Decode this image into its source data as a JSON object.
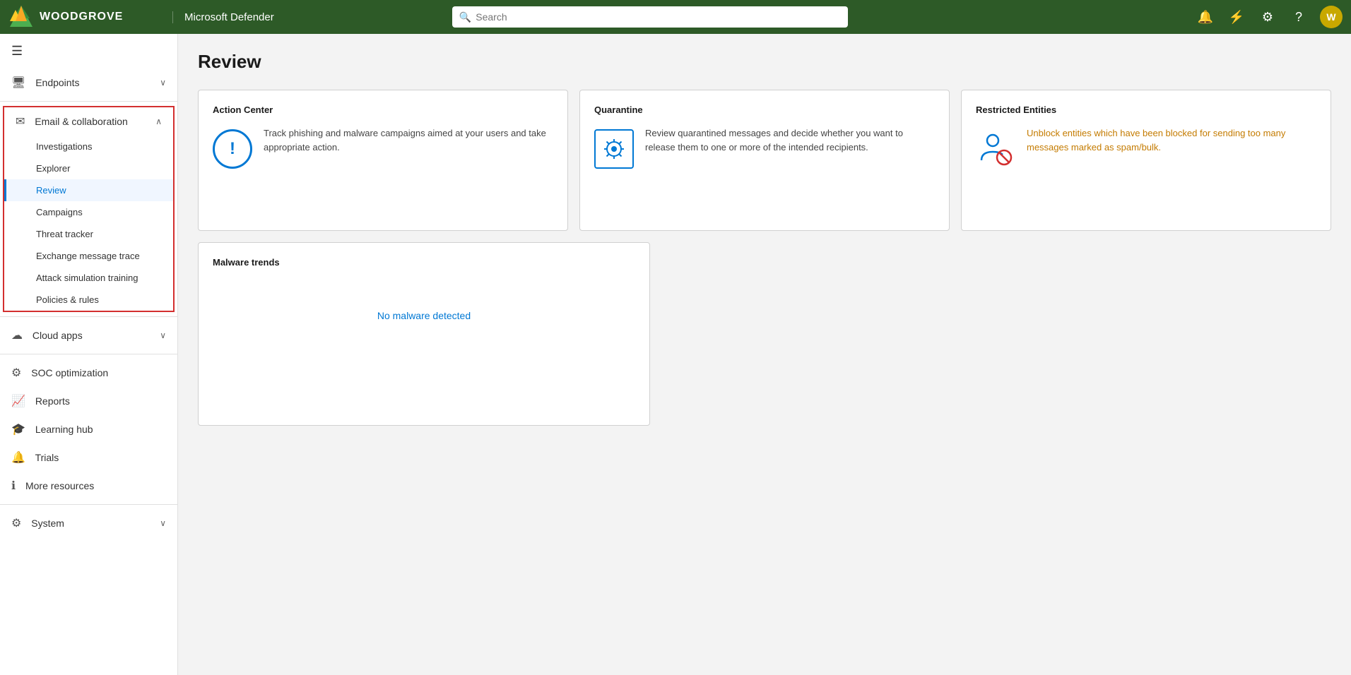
{
  "topnav": {
    "logo_text": "WOODGROVE",
    "app_title": "Microsoft Defender",
    "search_placeholder": "Search",
    "avatar_initials": "W"
  },
  "sidebar": {
    "hamburger_label": "☰",
    "sections": [
      {
        "id": "endpoints",
        "icon": "🖥",
        "label": "Endpoints",
        "expanded": false,
        "items": []
      },
      {
        "id": "email-collaboration",
        "icon": "✉",
        "label": "Email & collaboration",
        "expanded": true,
        "highlighted": true,
        "items": [
          {
            "id": "investigations",
            "label": "Investigations",
            "active": false
          },
          {
            "id": "explorer",
            "label": "Explorer",
            "active": false
          },
          {
            "id": "review",
            "label": "Review",
            "active": true
          },
          {
            "id": "campaigns",
            "label": "Campaigns",
            "active": false
          },
          {
            "id": "threat-tracker",
            "label": "Threat tracker",
            "active": false
          },
          {
            "id": "exchange-message-trace",
            "label": "Exchange message trace",
            "active": false
          },
          {
            "id": "attack-simulation-training",
            "label": "Attack simulation training",
            "active": false
          },
          {
            "id": "policies-rules",
            "label": "Policies & rules",
            "active": false
          }
        ]
      },
      {
        "id": "cloud-apps",
        "icon": "☁",
        "label": "Cloud apps",
        "expanded": false,
        "items": []
      }
    ],
    "standalone_items": [
      {
        "id": "soc-optimization",
        "icon": "⚙",
        "label": "SOC optimization"
      },
      {
        "id": "reports",
        "icon": "📈",
        "label": "Reports"
      },
      {
        "id": "learning-hub",
        "icon": "🎓",
        "label": "Learning hub"
      },
      {
        "id": "trials",
        "icon": "🔔",
        "label": "Trials"
      },
      {
        "id": "more-resources",
        "icon": "ℹ",
        "label": "More resources"
      }
    ],
    "bottom_sections": [
      {
        "id": "system",
        "icon": "⚙",
        "label": "System",
        "expanded": false
      }
    ]
  },
  "content": {
    "page_title": "Review",
    "cards": [
      {
        "id": "action-center",
        "title": "Action Center",
        "description": "Track phishing and malware campaigns aimed at your users and take appropriate action."
      },
      {
        "id": "quarantine",
        "title": "Quarantine",
        "description": "Review quarantined messages and decide whether you want to release them to one or more of the intended recipients."
      },
      {
        "id": "restricted-entities",
        "title": "Restricted Entities",
        "description": "Unblock entities which have been blocked for sending too many messages marked as spam/bulk."
      }
    ],
    "malware_card": {
      "title": "Malware trends",
      "no_malware_text": "No malware detected"
    }
  }
}
